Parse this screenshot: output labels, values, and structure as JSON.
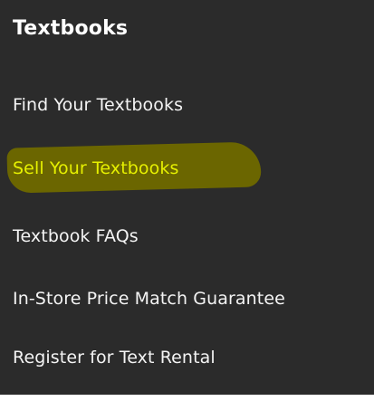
{
  "menu": {
    "title": "Textbooks",
    "items": [
      {
        "label": "Find Your Textbooks"
      },
      {
        "label": "Sell Your Textbooks",
        "highlighted": true
      },
      {
        "label": "Textbook FAQs"
      },
      {
        "label": "In-Store Price Match Guarantee"
      },
      {
        "label": "Register for Text Rental"
      }
    ]
  },
  "colors": {
    "panel_background": "#2b2b2b",
    "text": "#f4f4f4",
    "highlighted_text": "#e6f000",
    "highlighter_mark": "#6b6600"
  }
}
